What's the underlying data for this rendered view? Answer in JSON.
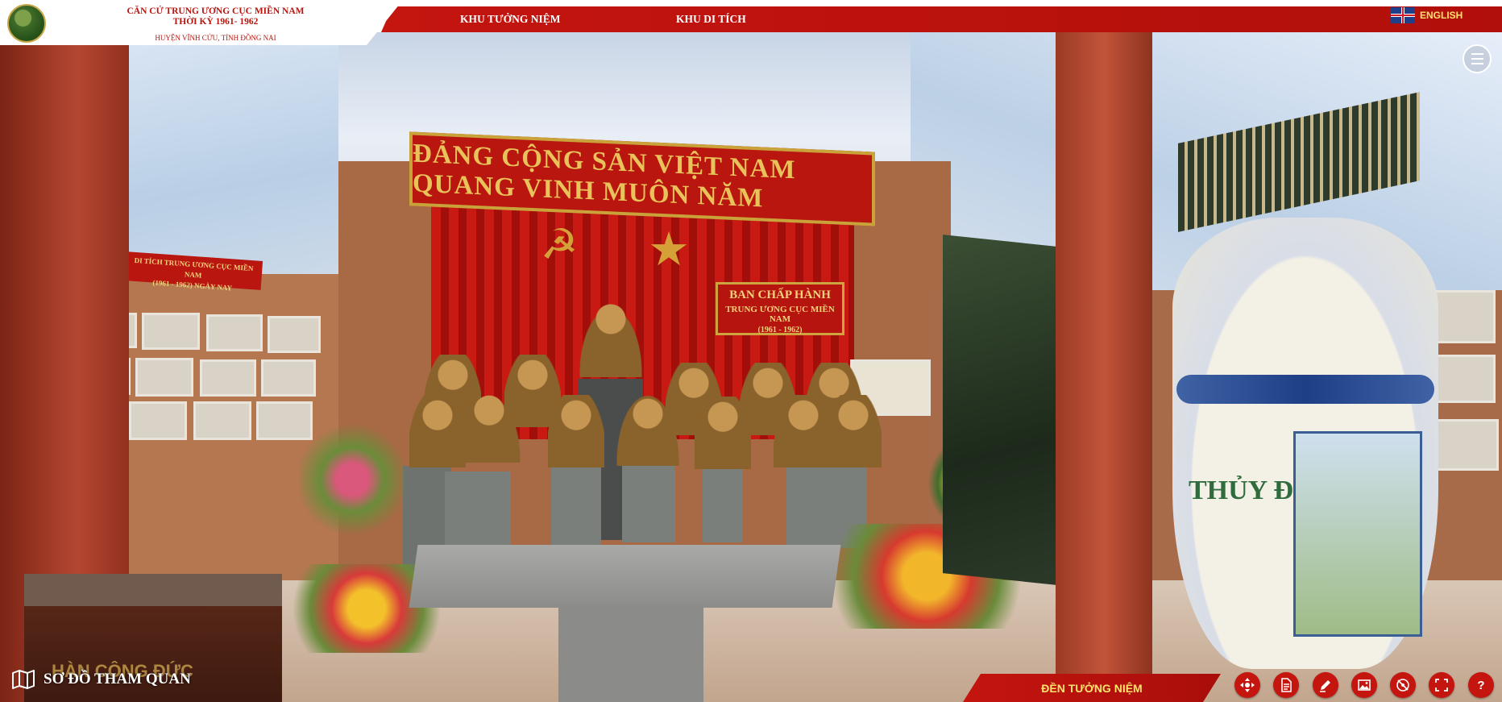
{
  "header": {
    "site_title_line1": "CĂN CỨ TRUNG ƯƠNG CỤC MIỀN NAM",
    "site_title_line2": "THỜI KỲ 1961- 1962",
    "site_subtitle": "HUYỆN VĨNH CỬU, TỈNH ĐỒNG NAI",
    "logo_icon": "organization-seal-icon"
  },
  "nav": {
    "items": [
      {
        "label": "KHU TƯỞNG NIỆM"
      },
      {
        "label": "KHU DI TÍCH"
      }
    ],
    "language": {
      "label": "ENGLISH",
      "icon": "uk-flag-icon"
    },
    "menu_icon": "hamburger-menu-icon"
  },
  "scene": {
    "banner_text": "ĐẢNG CỘNG SẢN VIỆT NAM QUANG VINH MUÔN NĂM",
    "plaque_line1": "BAN CHẤP HÀNH",
    "plaque_line2": "TRUNG ƯƠNG CỤC MIỀN NAM",
    "plaque_line3": "(1961 - 1962)",
    "left_sign_line1": "DI TÍCH TRUNG ƯƠNG CỤC MIỀN NAM",
    "left_sign_line2": "(1961 - 1962) NGÀY NAY",
    "vase_text": "THỦY ĐỒNG NAI",
    "engraved_text": "HÀN CÔNG ĐỨC"
  },
  "bottom": {
    "map_label": "SƠ ĐỒ THAM QUAN",
    "map_icon": "map-icon",
    "location_label": "ĐỀN TƯỞNG NIỆM",
    "tools": [
      {
        "name": "navigate-icon"
      },
      {
        "name": "document-icon"
      },
      {
        "name": "edit-icon"
      },
      {
        "name": "gallery-icon"
      },
      {
        "name": "gyroscope-icon"
      },
      {
        "name": "fullscreen-icon"
      },
      {
        "name": "help-icon"
      }
    ]
  },
  "colors": {
    "accent_red": "#c4150f",
    "label_yellow": "#ffe36b",
    "title_red": "#b8140e"
  }
}
